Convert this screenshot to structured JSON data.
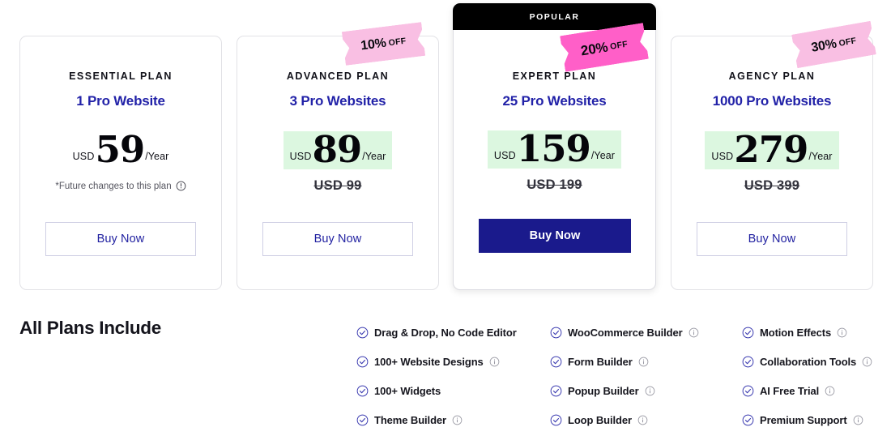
{
  "plans": [
    {
      "name": "ESSENTIAL PLAN",
      "sites": "1 Pro Website",
      "currency": "USD",
      "amount": "59",
      "period": "/Year",
      "old_price": "",
      "note": "*Future changes to this plan",
      "badge_pct": "",
      "badge_off": "",
      "cta": "Buy Now",
      "featured": false,
      "popular_label": ""
    },
    {
      "name": "ADVANCED PLAN",
      "sites": "3 Pro Websites",
      "currency": "USD",
      "amount": "89",
      "period": "/Year",
      "old_price": "USD 99",
      "note": "",
      "badge_pct": "10%",
      "badge_off": "OFF",
      "cta": "Buy Now",
      "featured": false,
      "popular_label": ""
    },
    {
      "name": "EXPERT PLAN",
      "sites": "25 Pro Websites",
      "currency": "USD",
      "amount": "159",
      "period": "/Year",
      "old_price": "USD 199",
      "note": "",
      "badge_pct": "20%",
      "badge_off": "OFF",
      "cta": "Buy Now",
      "featured": true,
      "popular_label": "POPULAR"
    },
    {
      "name": "AGENCY PLAN",
      "sites": "1000 Pro Websites",
      "currency": "USD",
      "amount": "279",
      "period": "/Year",
      "old_price": "USD 399",
      "note": "",
      "badge_pct": "30%",
      "badge_off": "OFF",
      "cta": "Buy Now",
      "featured": false,
      "popular_label": ""
    }
  ],
  "include": {
    "title": "All Plans Include",
    "columns": [
      [
        {
          "label": "Drag & Drop, No Code Editor",
          "info": false
        },
        {
          "label": "100+ Website Designs",
          "info": true
        },
        {
          "label": "100+ Widgets",
          "info": false
        },
        {
          "label": "Theme Builder",
          "info": true
        }
      ],
      [
        {
          "label": "WooCommerce Builder",
          "info": true
        },
        {
          "label": "Form Builder",
          "info": true
        },
        {
          "label": "Popup Builder",
          "info": true
        },
        {
          "label": "Loop Builder",
          "info": true
        }
      ],
      [
        {
          "label": "Motion Effects",
          "info": true
        },
        {
          "label": "Collaboration Tools",
          "info": true
        },
        {
          "label": "AI Free Trial",
          "info": true
        },
        {
          "label": "Premium Support",
          "info": true
        }
      ]
    ]
  },
  "colors": {
    "accent_navy": "#2222a8",
    "cta_navy": "#1a1a8c",
    "highlight_green": "#dcf7e0",
    "badge_pink": "#f9bfe3",
    "badge_pink_bright": "#ff5fc8",
    "popular_black": "#000000"
  }
}
